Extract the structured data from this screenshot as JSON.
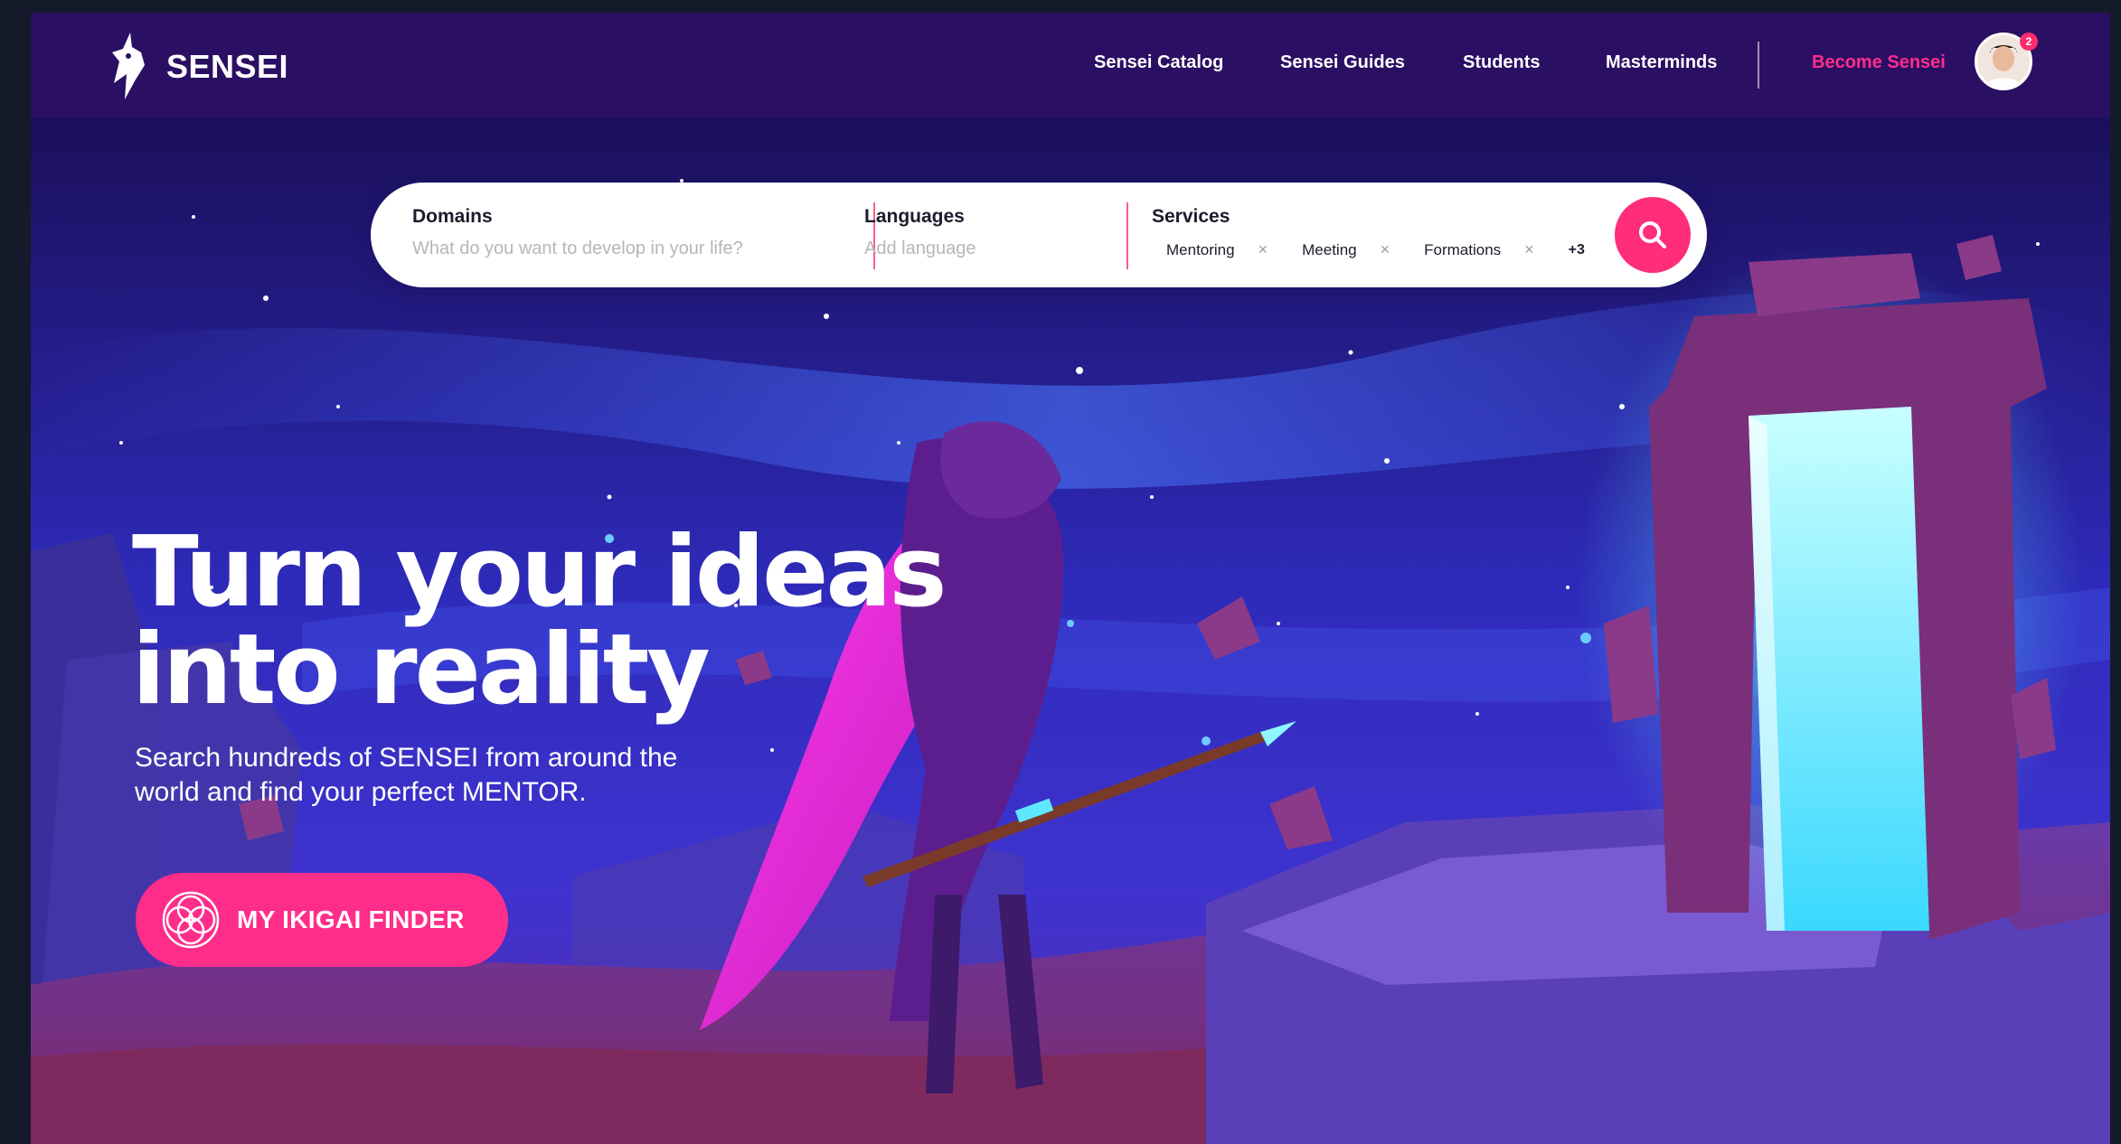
{
  "brand": {
    "name": "SENSEI"
  },
  "nav": {
    "links": [
      "Sensei Catalog",
      "Sensei Guides",
      "Students",
      "Masterminds"
    ],
    "cta": "Become Sensei",
    "notification_count": "2"
  },
  "search": {
    "domains": {
      "label": "Domains",
      "placeholder": "What do you want to develop in your life?"
    },
    "languages": {
      "label": "Languages",
      "placeholder": "Add language"
    },
    "services": {
      "label": "Services",
      "chips": [
        "Mentoring",
        "Meeting",
        "Formations"
      ],
      "more": "+3"
    }
  },
  "hero": {
    "headline": "Turn your ideas\ninto reality",
    "subline": "Search hundreds of SENSEI from around the world and find your perfect MENTOR.",
    "cta_label": "MY IKIGAI FINDER"
  },
  "colors": {
    "nav_bg": "#2b0f63",
    "accent": "#ff2d8a",
    "sky_top": "#1b0f5a",
    "portal": "#7ff8ff"
  },
  "icons": [
    "fox-logo-icon",
    "search-icon",
    "close-icon",
    "ikigai-icon",
    "avatar"
  ]
}
